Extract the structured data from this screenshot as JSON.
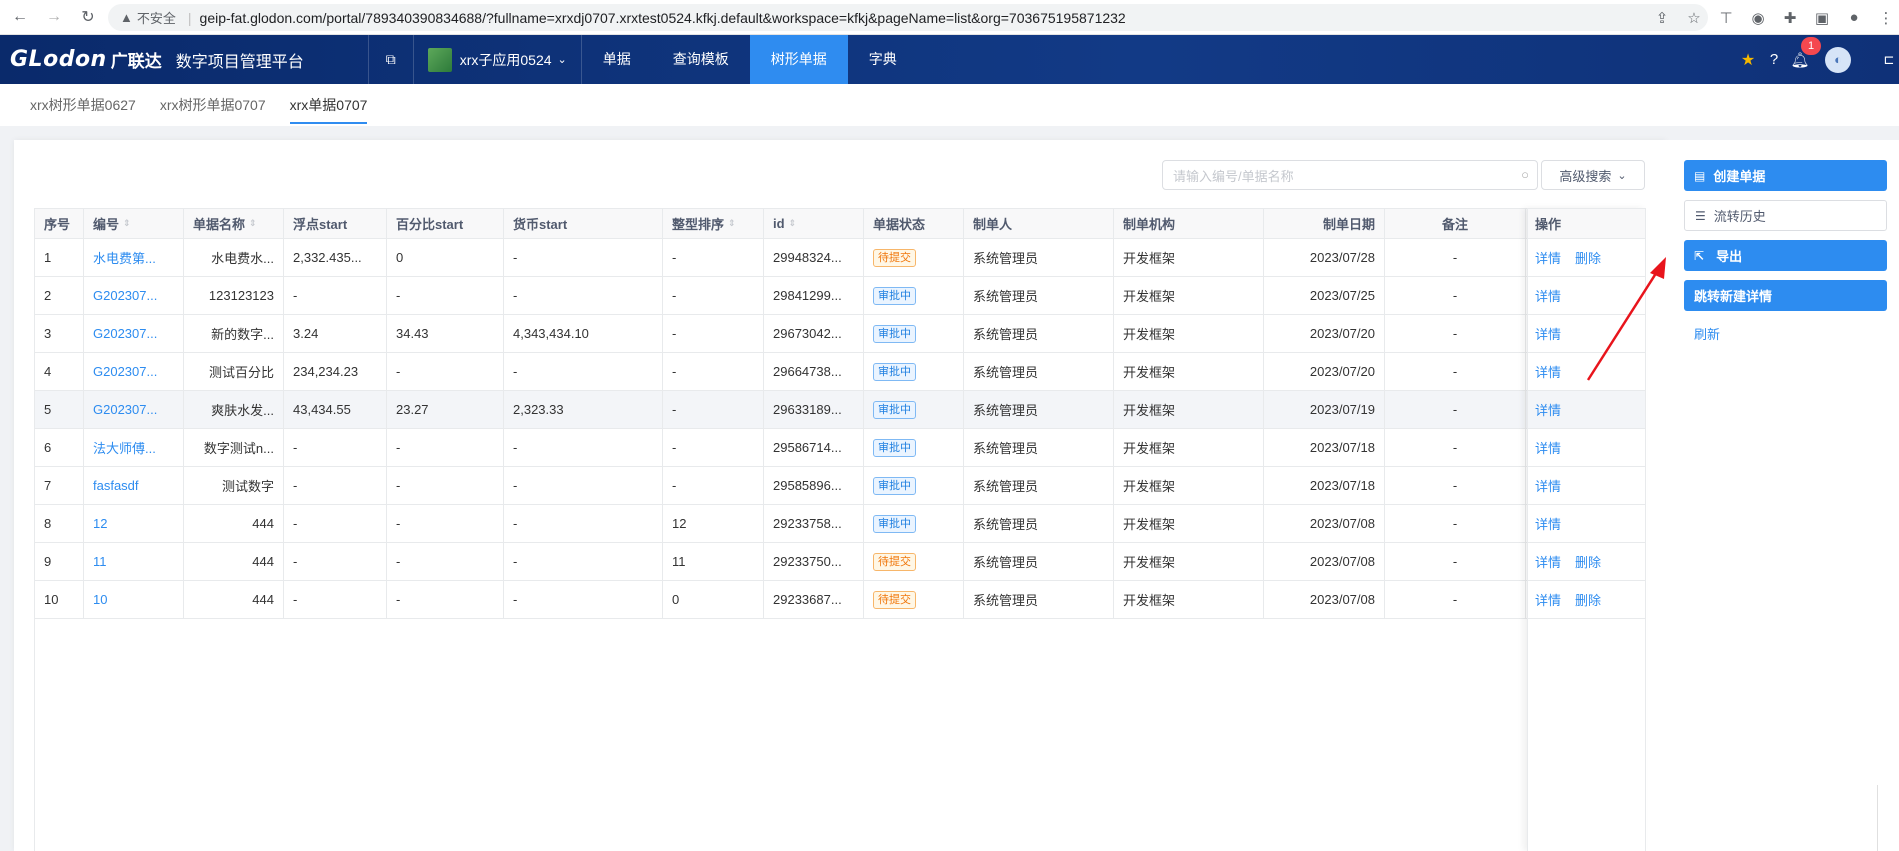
{
  "browser": {
    "security": "不安全",
    "url": "geip-fat.glodon.com/portal/789340390834688/?fullname=xrxdj0707.xrxtest0524.kfkj.default&workspace=kfkj&pageName=list&org=703675195871232"
  },
  "header": {
    "logo": "GLodon",
    "logo_cn": "广联达",
    "platform": "数字项目管理平台",
    "app_name": "xrx子应用0524",
    "menu": [
      {
        "label": "单据",
        "active": false
      },
      {
        "label": "查询模板",
        "active": false
      },
      {
        "label": "树形单据",
        "active": true
      },
      {
        "label": "字典",
        "active": false
      }
    ],
    "notification_count": "1"
  },
  "tabs": [
    {
      "label": "xrx树形单据0627",
      "active": false
    },
    {
      "label": "xrx树形单据0707",
      "active": false
    },
    {
      "label": "xrx单据0707",
      "active": true
    }
  ],
  "toolbar": {
    "search_placeholder": "请输入编号/单据名称",
    "advanced_search": "高级搜索"
  },
  "table": {
    "columns": [
      {
        "key": "seq",
        "label": "序号",
        "sortable": false
      },
      {
        "key": "code",
        "label": "编号",
        "sortable": true
      },
      {
        "key": "name",
        "label": "单据名称",
        "sortable": true
      },
      {
        "key": "float",
        "label": "浮点start",
        "sortable": false
      },
      {
        "key": "percent",
        "label": "百分比start",
        "sortable": false
      },
      {
        "key": "currency",
        "label": "货币start",
        "sortable": false
      },
      {
        "key": "intsort",
        "label": "整型排序",
        "sortable": true
      },
      {
        "key": "id",
        "label": "id",
        "sortable": true
      },
      {
        "key": "status",
        "label": "单据状态",
        "sortable": false
      },
      {
        "key": "creator",
        "label": "制单人",
        "sortable": false
      },
      {
        "key": "org",
        "label": "制单机构",
        "sortable": false
      },
      {
        "key": "date",
        "label": "制单日期",
        "sortable": false
      },
      {
        "key": "remark",
        "label": "备注",
        "sortable": false
      },
      {
        "key": "ops",
        "label": "操作",
        "sortable": false
      }
    ],
    "rows": [
      {
        "seq": "1",
        "code": "水电费第...",
        "name": "水电费水...",
        "float": "2,332.435...",
        "percent": "0",
        "currency": "-",
        "intsort": "-",
        "id": "29948324...",
        "status": "待提交",
        "status_type": "pending",
        "creator": "系统管理员",
        "org": "开发框架",
        "date": "2023/07/28",
        "remark": "-",
        "ops": [
          "详情",
          "删除"
        ]
      },
      {
        "seq": "2",
        "code": "G202307...",
        "name": "123123123",
        "float": "-",
        "percent": "-",
        "currency": "-",
        "intsort": "-",
        "id": "29841299...",
        "status": "审批中",
        "status_type": "approving",
        "creator": "系统管理员",
        "org": "开发框架",
        "date": "2023/07/25",
        "remark": "-",
        "ops": [
          "详情"
        ]
      },
      {
        "seq": "3",
        "code": "G202307...",
        "name": "新的数字...",
        "float": "3.24",
        "percent": "34.43",
        "currency": "4,343,434.10",
        "intsort": "-",
        "id": "29673042...",
        "status": "审批中",
        "status_type": "approving",
        "creator": "系统管理员",
        "org": "开发框架",
        "date": "2023/07/20",
        "remark": "-",
        "ops": [
          "详情"
        ]
      },
      {
        "seq": "4",
        "code": "G202307...",
        "name": "测试百分比",
        "float": "234,234.23",
        "percent": "-",
        "currency": "-",
        "intsort": "-",
        "id": "29664738...",
        "status": "审批中",
        "status_type": "approving",
        "creator": "系统管理员",
        "org": "开发框架",
        "date": "2023/07/20",
        "remark": "-",
        "ops": [
          "详情"
        ]
      },
      {
        "seq": "5",
        "code": "G202307...",
        "name": "爽肤水发...",
        "float": "43,434.55",
        "percent": "23.27",
        "currency": "2,323.33",
        "intsort": "-",
        "id": "29633189...",
        "status": "审批中",
        "status_type": "approving",
        "creator": "系统管理员",
        "org": "开发框架",
        "date": "2023/07/19",
        "remark": "-",
        "ops": [
          "详情"
        ]
      },
      {
        "seq": "6",
        "code": "法大师傅...",
        "name": "数字测试n...",
        "float": "-",
        "percent": "-",
        "currency": "-",
        "intsort": "-",
        "id": "29586714...",
        "status": "审批中",
        "status_type": "approving",
        "creator": "系统管理员",
        "org": "开发框架",
        "date": "2023/07/18",
        "remark": "-",
        "ops": [
          "详情"
        ]
      },
      {
        "seq": "7",
        "code": "fasfasdf",
        "name": "测试数字",
        "float": "-",
        "percent": "-",
        "currency": "-",
        "intsort": "-",
        "id": "29585896...",
        "status": "审批中",
        "status_type": "approving",
        "creator": "系统管理员",
        "org": "开发框架",
        "date": "2023/07/18",
        "remark": "-",
        "ops": [
          "详情"
        ]
      },
      {
        "seq": "8",
        "code": "12",
        "name": "444",
        "float": "-",
        "percent": "-",
        "currency": "-",
        "intsort": "12",
        "id": "29233758...",
        "status": "审批中",
        "status_type": "approving",
        "creator": "系统管理员",
        "org": "开发框架",
        "date": "2023/07/08",
        "remark": "-",
        "ops": [
          "详情"
        ]
      },
      {
        "seq": "9",
        "code": "11",
        "name": "444",
        "float": "-",
        "percent": "-",
        "currency": "-",
        "intsort": "11",
        "id": "29233750...",
        "status": "待提交",
        "status_type": "pending",
        "creator": "系统管理员",
        "org": "开发框架",
        "date": "2023/07/08",
        "remark": "-",
        "ops": [
          "详情",
          "删除"
        ]
      },
      {
        "seq": "10",
        "code": "10",
        "name": "444",
        "float": "-",
        "percent": "-",
        "currency": "-",
        "intsort": "0",
        "id": "29233687...",
        "status": "待提交",
        "status_type": "pending",
        "creator": "系统管理员",
        "org": "开发框架",
        "date": "2023/07/08",
        "remark": "-",
        "ops": [
          "详情",
          "删除"
        ]
      }
    ]
  },
  "right_panel": {
    "create": "创建单据",
    "history": "流转历史",
    "export": "导出",
    "jump": "跳转新建详情",
    "refresh": "刷新"
  },
  "colors": {
    "header_bg": "#123a86",
    "primary": "#2d8cf0",
    "annotation": "#e8141c"
  }
}
